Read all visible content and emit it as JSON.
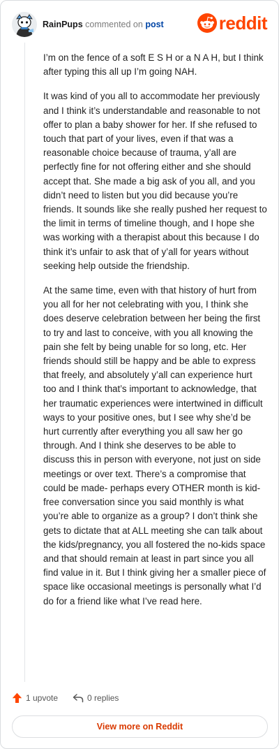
{
  "header": {
    "username": "RainPups",
    "commented_on": "commented on",
    "post_link": "post",
    "brand": "reddit",
    "avatar_icon": "snoo-avatar-icon",
    "logo_icon": "reddit-alien-icon",
    "brand_color": "#ff4500"
  },
  "comment": {
    "paragraphs": [
      "I’m on the fence of a soft E S H or a N A H, but I think after typing this all up I’m going NAH.",
      "It was kind of you all to accommodate her previously and I think it’s understandable and reasonable to not offer to plan a baby shower for her. If she refused to touch that part of your lives, even if that was a reasonable choice because of trauma, y’all are perfectly fine for not offering either and she should accept that. She made a big ask of you all, and you didn’t need to listen but you did because you’re friends. It sounds like she really pushed her request to the limit in terms of timeline though, and I hope she was working with a therapist about this because I do think it’s unfair to ask that of y’all for years without seeking help outside the friendship.",
      "At the same time, even with that history of hurt from you all for her not celebrating with you, I think she does deserve celebration between her being the first to try and last to conceive, with you all knowing the pain she felt by being unable for so long, etc. Her friends should still be happy and be able to express that freely, and absolutely y’all can experience hurt too and I think that’s important to acknowledge, that her traumatic experiences were intertwined in difficult ways to your positive ones, but I see why she’d be hurt currently after everything you all saw her go through. And I think she deserves to be able to discuss this in person with everyone, not just on side meetings or over text. There’s a compromise that could be made- perhaps every OTHER month is kid-free conversation since you said monthly is what you’re able to organize as a group? I don’t think she gets to dictate that at ALL meeting she can talk about the kids/pregnancy, you all fostered the no-kids space and that should remain at least in part since you all find value in it. But I think giving her a smaller piece of space like occasional meetings is personally what I’d do for a friend like what I’ve read here."
    ]
  },
  "actions": {
    "upvote_label": "1 upvote",
    "upvote_icon": "upvote-arrow-icon",
    "upvote_color": "#ff4500",
    "replies_label": "0 replies",
    "replies_icon": "reply-arrow-icon"
  },
  "footer": {
    "view_more_label": "View more on Reddit",
    "view_more_color": "#d93a00"
  }
}
